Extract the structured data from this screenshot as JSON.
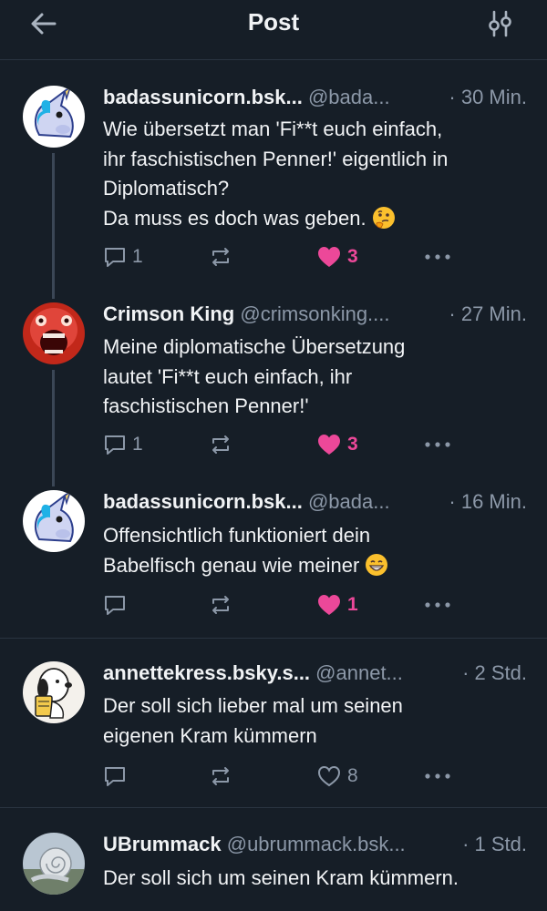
{
  "header": {
    "title": "Post",
    "back_icon": "arrow-left-icon",
    "filter_icon": "sliders-icon"
  },
  "colors": {
    "background": "#161e27",
    "like": "#ec4899",
    "muted": "#8c98a8",
    "text": "#f1f3f5"
  },
  "posts": [
    {
      "display_name": "badassunicorn.bsk...",
      "handle": "@bada...",
      "time": "· 30 Min.",
      "text_lines": [
        "Wie übersetzt man 'Fi**t euch einfach,",
        "ihr faschistischen Penner!' eigentlich in",
        "Diplomatisch?",
        "Da muss es doch was geben."
      ],
      "emoji": "thinking-face",
      "replies": "1",
      "reposts": "",
      "likes": "3",
      "liked": true
    },
    {
      "display_name": "Crimson King",
      "handle": "@crimsonking....",
      "time": "· 27 Min.",
      "text_lines": [
        "Meine diplomatische Übersetzung",
        "lautet 'Fi**t euch einfach, ihr",
        "faschistischen Penner!'"
      ],
      "replies": "1",
      "reposts": "",
      "likes": "3",
      "liked": true
    },
    {
      "display_name": "badassunicorn.bsk...",
      "handle": "@bada...",
      "time": "· 16 Min.",
      "text_lines": [
        "Offensichtlich funktioniert dein",
        "Babelfisch genau wie meiner"
      ],
      "emoji": "grinning-face",
      "replies": "",
      "reposts": "",
      "likes": "1",
      "liked": true
    },
    {
      "display_name": "annettekress.bsky.s...",
      "handle": "@annet...",
      "time": "· 2 Std.",
      "text_lines": [
        "Der soll sich lieber mal um seinen",
        "eigenen Kram kümmern"
      ],
      "replies": "",
      "reposts": "",
      "likes": "8",
      "liked": false
    },
    {
      "display_name": "UBrummack",
      "handle": "@ubrummack.bsk...",
      "time": "· 1 Std.",
      "text_lines": [
        "Der soll sich um seinen Kram kümmern."
      ]
    }
  ]
}
